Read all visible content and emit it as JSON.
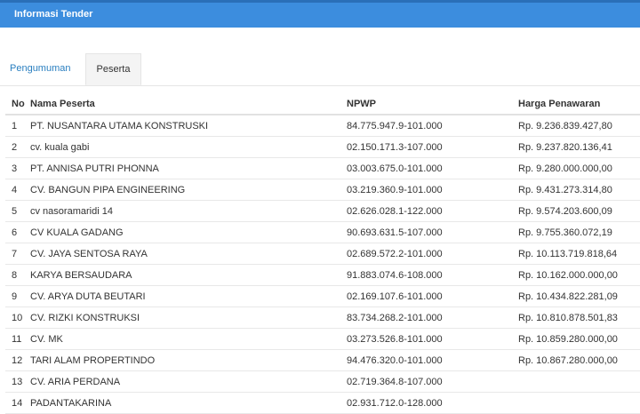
{
  "panel": {
    "title": "Informasi Tender"
  },
  "tabs": [
    {
      "label": "Pengumuman",
      "active": false
    },
    {
      "label": "Peserta",
      "active": true
    }
  ],
  "table": {
    "headers": {
      "no": "No",
      "name": "Nama Peserta",
      "npwp": "NPWP",
      "price": "Harga Penawaran"
    },
    "rows": [
      {
        "no": "1",
        "name": "PT. NUSANTARA UTAMA KONSTRUSKI",
        "npwp": "84.775.947.9-101.000",
        "price": "Rp. 9.236.839.427,80"
      },
      {
        "no": "2",
        "name": "cv. kuala gabi",
        "npwp": "02.150.171.3-107.000",
        "price": "Rp. 9.237.820.136,41"
      },
      {
        "no": "3",
        "name": "PT. ANNISA PUTRI PHONNA",
        "npwp": "03.003.675.0-101.000",
        "price": "Rp. 9.280.000.000,00"
      },
      {
        "no": "4",
        "name": "CV. BANGUN PIPA ENGINEERING",
        "npwp": "03.219.360.9-101.000",
        "price": "Rp. 9.431.273.314,80"
      },
      {
        "no": "5",
        "name": "cv nasoramaridi 14",
        "npwp": "02.626.028.1-122.000",
        "price": "Rp. 9.574.203.600,09"
      },
      {
        "no": "6",
        "name": "CV KUALA GADANG",
        "npwp": "90.693.631.5-107.000",
        "price": "Rp. 9.755.360.072,19"
      },
      {
        "no": "7",
        "name": "CV. JAYA SENTOSA RAYA",
        "npwp": "02.689.572.2-101.000",
        "price": "Rp. 10.113.719.818,64"
      },
      {
        "no": "8",
        "name": "KARYA BERSAUDARA",
        "npwp": "91.883.074.6-108.000",
        "price": "Rp. 10.162.000.000,00"
      },
      {
        "no": "9",
        "name": "CV. ARYA DUTA BEUTARI",
        "npwp": "02.169.107.6-101.000",
        "price": "Rp. 10.434.822.281,09"
      },
      {
        "no": "10",
        "name": "CV. RIZKI KONSTRUKSI",
        "npwp": "83.734.268.2-101.000",
        "price": "Rp. 10.810.878.501,83"
      },
      {
        "no": "11",
        "name": "CV. MK",
        "npwp": "03.273.526.8-101.000",
        "price": "Rp. 10.859.280.000,00"
      },
      {
        "no": "12",
        "name": "TARI ALAM PROPERTINDO",
        "npwp": "94.476.320.0-101.000",
        "price": "Rp. 10.867.280.000,00"
      },
      {
        "no": "13",
        "name": "CV. ARIA PERDANA",
        "npwp": "02.719.364.8-107.000",
        "price": ""
      },
      {
        "no": "14",
        "name": "PADANTAKARINA",
        "npwp": "02.931.712.0-128.000",
        "price": ""
      }
    ]
  }
}
